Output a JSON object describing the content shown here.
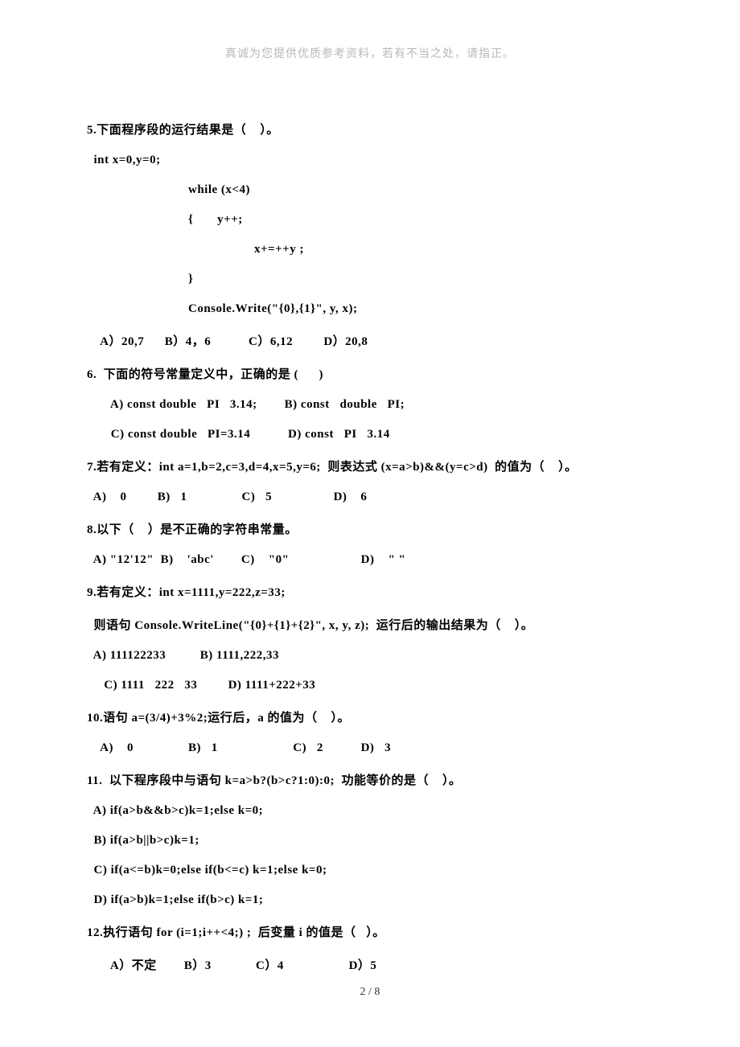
{
  "header": {
    "note": "真诚为您提供优质参考资料，若有不当之处，请指正。"
  },
  "q5": {
    "stem": "5.下面程序段的运行结果是（    ）。",
    "l1": "  int x=0,y=0;",
    "l2": "while (x<4)",
    "l3": "{       y++;",
    "l4": "x+=++y ;",
    "l5": "}",
    "l6": "Console.Write(\"{0},{1}\", y, x);",
    "opts": "    A）20,7      B）4，6           C）6,12         D）20,8"
  },
  "q6": {
    "stem": "6.  下面的符号常量定义中，正确的是 (      )",
    "r1": "       A) const double   PI   3.14;        B) const   double   PI;",
    "r2": "       C) const double   PI=3.14           D) const   PI   3.14"
  },
  "q7": {
    "stem": "7.若有定义：int a=1,b=2,c=3,d=4,x=5,y=6;  则表达式 (x=a>b)&&(y=c>d)  的值为（    ）。",
    "opts": "  A)    0         B)   1                C)   5                  D)    6"
  },
  "q8": {
    "stem": "8.以下（    ）是不正确的字符串常量。",
    "opts": "  A) \"12'12\"  B)    'abc'        C)    \"0\"                     D)    \" \""
  },
  "q9": {
    "stem": "9.若有定义：int x=1111,y=222,z=33;",
    "l2": "  则语句 Console.WriteLine(\"{0}+{1}+{2}\", x, y, z);  运行后的输出结果为（    ）。",
    "r1": "  A) 111122233          B) 1111,222,33",
    "r2": "     C) 1111   222   33         D) 1111+222+33"
  },
  "q10": {
    "stem": "10.语句 a=(3/4)+3%2;运行后，a 的值为（    ）。",
    "opts": "    A)    0                B)   1                      C)   2           D)   3"
  },
  "q11": {
    "stem": "11.  以下程序段中与语句 k=a>b?(b>c?1:0):0;  功能等价的是（    ）。",
    "a": "  A) if(a>b&&b>c)k=1;else k=0;",
    "b": "  B) if(a>b||b>c)k=1;",
    "c": "  C) if(a<=b)k=0;else if(b<=c) k=1;else k=0;",
    "d": "  D) if(a>b)k=1;else if(b>c) k=1;"
  },
  "q12": {
    "stem": "12.执行语句 for (i=1;i++<4;) ;  后变量 i 的值是（   ）。",
    "opts": "       A）不定        B）3             C）4                   D）5"
  },
  "footer": {
    "page": "2 / 8"
  }
}
